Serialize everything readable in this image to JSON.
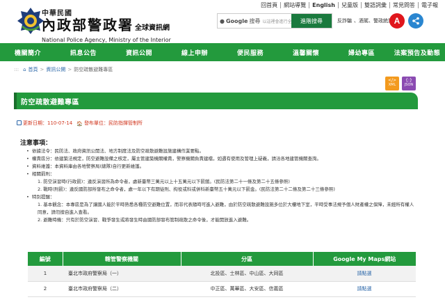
{
  "header": {
    "country": "中華民國",
    "agency_name": "內政部警政署",
    "agency_suffix": "全球資訊網",
    "agency_en": "National Police Agency, Ministry of the Interior",
    "top_links": [
      "回首頁",
      "網站導覽",
      "English",
      "兒童版",
      "雙語詞彙",
      "常見問答",
      "電子報"
    ],
    "search": {
      "engine_label": "Google",
      "engine_sub": "搜尋",
      "placeholder": "以這裡會進行全文搜尋檢索",
      "button": "進階搜尋"
    },
    "fraud_text": "反詐騙",
    "fraud_extra": "、酒駕、警政統計...",
    "a_label": "A",
    "accent_red": "#e0161c",
    "share_blue": "#2a86d0"
  },
  "nav": {
    "items": [
      "機關簡介",
      "訊息公告",
      "資訊公開",
      "線上申辦",
      "便民服務",
      "溫馨關懷",
      "婦幼專區",
      "法案預告及動態"
    ],
    "color": "#239a3d"
  },
  "breadcrumb": {
    "dots": ":::",
    "home": "首頁",
    "level1": "資訊公開",
    "current": "防空疏散避難專區"
  },
  "tools": {
    "xml": "XML",
    "json": "JSON"
  },
  "page": {
    "title": "防空疏散避難專區",
    "updated_label": "更新日期：110-07-14",
    "publisher_label": "發布單位：民防指揮管制所"
  },
  "notes": {
    "title": "注意事項：",
    "items": [
      "依據法令：民防法、政府資訊公開法、地方制度法及防空疏散避難設施建構作業要點。",
      "權責區分：依建築法規定，防空避難設備之核定，屬主管建築機關權責，警察機關負責建檔，如遇有使用及管理上疑義，請洽各地建管機關查詢。",
      "資料維護：本資料庫由各地警察局(總隊)自行更新維護。",
      "相關罰則："
    ],
    "penalties": [
      "1. 防空演習時(行政罰)：違反演習所為命令者，處新臺幣三萬元以上十五萬元以下罰鍰。(民防法第二十一條及第二十五條參照)",
      "2. 戰時(刑罰)：違反國防部所發布之命令者，處一年以下有期徒刑、拘役或科或併科新臺幣五十萬元以下罰金。(民防法第二十二條及第二十三條參照)"
    ],
    "reminder_title": "特別提醒：",
    "reminders": [
      "1. 基本觀念：本專區是為了讓國人能於平時熟悉各種防空避難位置，而非代表隨時可進入避難，由於防空疏散避難設施多位於大樓地下室，平時受事法規予個人財產權之保障，未經所有權人同意，請勿擅自進入查看。",
      "2. 避難時機：只有於防空演習、戰爭發生或將發生時由國防部發布管制疏散之命令後，才能開放進入避難。"
    ]
  },
  "table": {
    "headers": [
      "編號",
      "轄管警察機關",
      "分區",
      "Google My Maps網站"
    ],
    "rows": [
      {
        "no": "1",
        "agency": "臺北市政府警察局（一）",
        "district": "北投區、士林區、中山區、大同區",
        "link": "請點選"
      },
      {
        "no": "2",
        "agency": "臺北市政府警察局（二）",
        "district": "中正區、萬華區、大安區、信義區",
        "link": "請點選"
      }
    ]
  }
}
